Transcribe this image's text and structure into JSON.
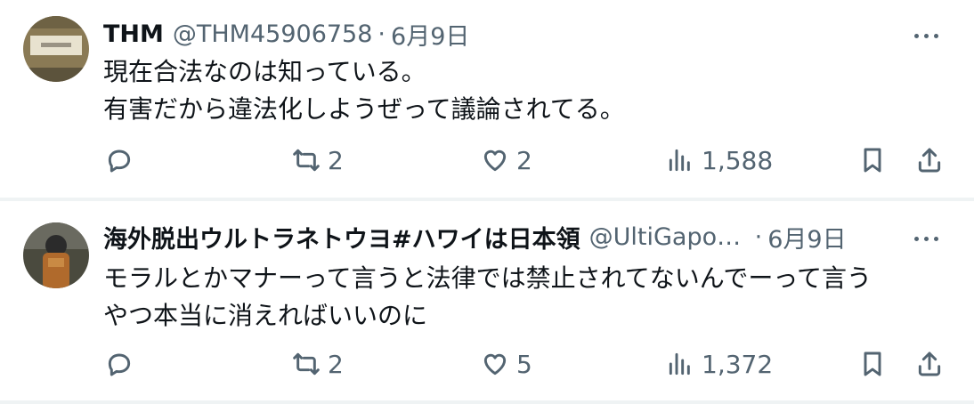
{
  "tweets": [
    {
      "name": "THM",
      "handle": "@THM45906758",
      "dot": "·",
      "date": "6月9日",
      "lines": [
        "現在合法なのは知っている。",
        "有害だから違法化しようぜって議論されてる。"
      ],
      "replies": "",
      "retweets": "2",
      "likes": "2",
      "views": "1,588",
      "avatar_colors": {
        "bg": "#8a7a55",
        "label": "#e8e2cf"
      }
    },
    {
      "name": "海外脱出ウルトラネトウヨ#ハワイは日本領",
      "handle": "@UltiGaponUyoTrump",
      "dot": "·",
      "date": "6月9日",
      "lines": [
        "モラルとかマナーって言うと法律では禁止されてないんでーって言う",
        "やつ本当に消えればいいのに"
      ],
      "replies": "",
      "retweets": "2",
      "likes": "5",
      "views": "1,372",
      "avatar_colors": {
        "bg": "#4a4a3e",
        "suit": "#b06a2c"
      }
    }
  ],
  "icons": {
    "reply": "reply-icon",
    "retweet": "retweet-icon",
    "like": "heart-icon",
    "views": "views-icon",
    "bookmark": "bookmark-icon",
    "share": "share-icon",
    "more": "more-icon"
  },
  "colors": {
    "text": "#0f1419",
    "secondary": "#536471",
    "separator": "#eff3f4"
  }
}
